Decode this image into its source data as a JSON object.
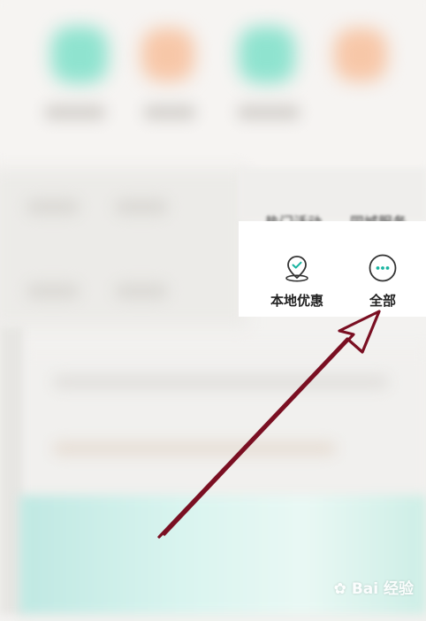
{
  "menu": {
    "partial_labels": [
      "热门活动",
      "同城服务"
    ],
    "items": [
      {
        "label": "本地优惠",
        "icon": "location-check-icon"
      },
      {
        "label": "全部",
        "icon": "more-dots-icon"
      }
    ]
  },
  "annotation": {
    "type": "arrow",
    "color": "#7a0f22",
    "points_to": "全部"
  },
  "watermark": {
    "text": "Bai 经验"
  },
  "colors": {
    "teal": "#19b4a0",
    "panel": "#ffffff",
    "arrow": "#7a0f22"
  }
}
